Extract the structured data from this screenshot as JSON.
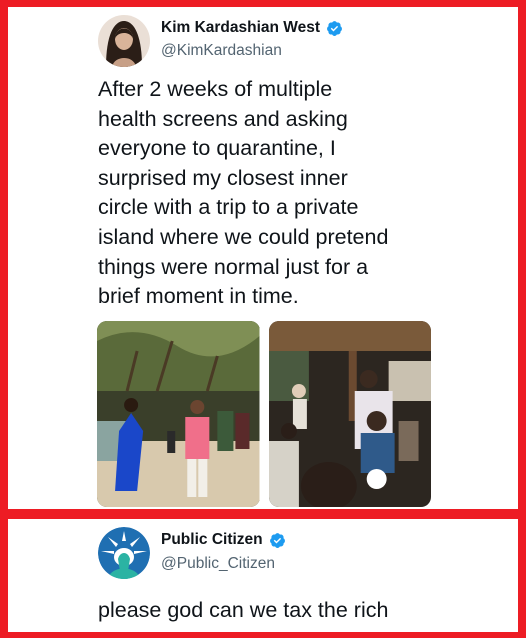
{
  "tweets": [
    {
      "display_name": "Kim Kardashian West",
      "handle": "@KimKardashian",
      "verified": true,
      "avatar_icon": "profile-photo-kim",
      "text_lines": [
        "After 2 weeks of multiple",
        "health screens and asking",
        "everyone to quarantine, I",
        "surprised my closest inner",
        "circle with a trip to a private",
        "island where we could pretend",
        "things were normal just for a",
        "brief moment in time."
      ],
      "media": [
        {
          "icon": "party-photo-left"
        },
        {
          "icon": "party-photo-right"
        }
      ]
    },
    {
      "display_name": "Public Citizen",
      "handle": "@Public_Citizen",
      "verified": true,
      "avatar_icon": "statue-of-liberty-logo",
      "text": "please god can we tax the rich"
    }
  ],
  "colors": {
    "border": "#ed1c24",
    "verified": "#1d9bf0",
    "text": "#0f1419",
    "handle": "#536471",
    "logo_blue": "#1f6fb2",
    "logo_teal": "#2bb3a3"
  }
}
